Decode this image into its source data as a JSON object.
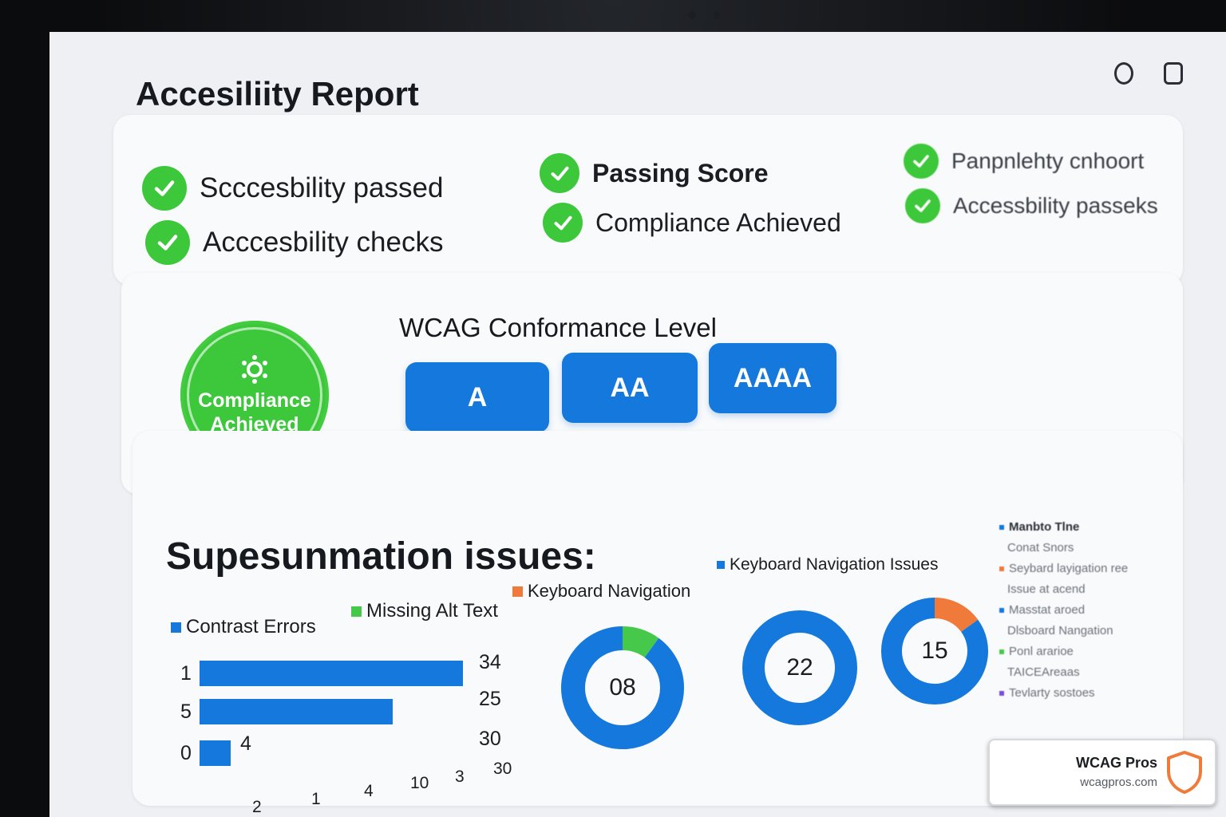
{
  "report": {
    "title": "Accesiliity Report"
  },
  "summary": {
    "items": [
      {
        "label": "Scccesbility passed"
      },
      {
        "label": "Acccesbility checks"
      },
      {
        "label": "Passing Score"
      },
      {
        "label": "Compliance Achieved"
      },
      {
        "label": "Panpnlehty cnhoort"
      },
      {
        "label": "Accessbility passeks"
      }
    ]
  },
  "compliance_badge": {
    "line1": "Compliance",
    "line2": "Achieved"
  },
  "wcag": {
    "title": "WCAG Conformance Level",
    "levels": [
      {
        "label": "A"
      },
      {
        "label": "AA"
      },
      {
        "label": "AAAA"
      }
    ]
  },
  "issues": {
    "title": "Supesunmation issues:",
    "legend": [
      {
        "label": "Contrast Errors",
        "color": "#1478dc"
      },
      {
        "label": "Missing Alt Text",
        "color": "#46c94a"
      },
      {
        "label": "Keyboard Navigation",
        "color": "#f07a3a"
      }
    ],
    "donut_legend": "Keyboard Navigation Issues",
    "side_legend": [
      {
        "label": "Manbto Tlne",
        "color": "#1478dc"
      },
      {
        "label": "Conat Snors",
        "color": ""
      },
      {
        "label": "Seybard layigation ree",
        "color": "#f07a3a"
      },
      {
        "label": "Issue at acend",
        "color": ""
      },
      {
        "label": "Masstat aroed",
        "color": "#1478dc"
      },
      {
        "label": "Dlsboard Nangation",
        "color": ""
      },
      {
        "label": "Ponl ararioe",
        "color": "#46c94a"
      },
      {
        "label": "TAICEAreaas",
        "color": ""
      },
      {
        "label": "Tevlarty sostoes",
        "color": "#7a4fd6"
      }
    ]
  },
  "chart_data": [
    {
      "type": "bar",
      "categories": [
        "1",
        "5",
        "0"
      ],
      "values": [
        34,
        25,
        4
      ],
      "right_labels": [
        "34",
        "25",
        "30"
      ],
      "x_tick_labels": [
        "2",
        "1",
        "4",
        "10",
        "3",
        "30"
      ],
      "colors": {
        "bar": "#1478dc"
      }
    },
    {
      "type": "pie",
      "center_label": "08",
      "slices": [
        {
          "name": "Missing Alt Text",
          "value": 10,
          "color": "#46c94a"
        },
        {
          "name": "Contrast Errors",
          "value": 90,
          "color": "#1478dc"
        }
      ]
    },
    {
      "type": "pie",
      "center_label": "22",
      "slices": [
        {
          "name": "Contrast Errors",
          "value": 100,
          "color": "#1478dc"
        }
      ]
    },
    {
      "type": "pie",
      "center_label": "15",
      "slices": [
        {
          "name": "Keyboard Navigation",
          "value": 15,
          "color": "#f07a3a"
        },
        {
          "name": "Contrast Errors",
          "value": 85,
          "color": "#1478dc"
        }
      ]
    }
  ],
  "brand": {
    "name": "WCAG Pros",
    "url": "wcagpros.com"
  }
}
